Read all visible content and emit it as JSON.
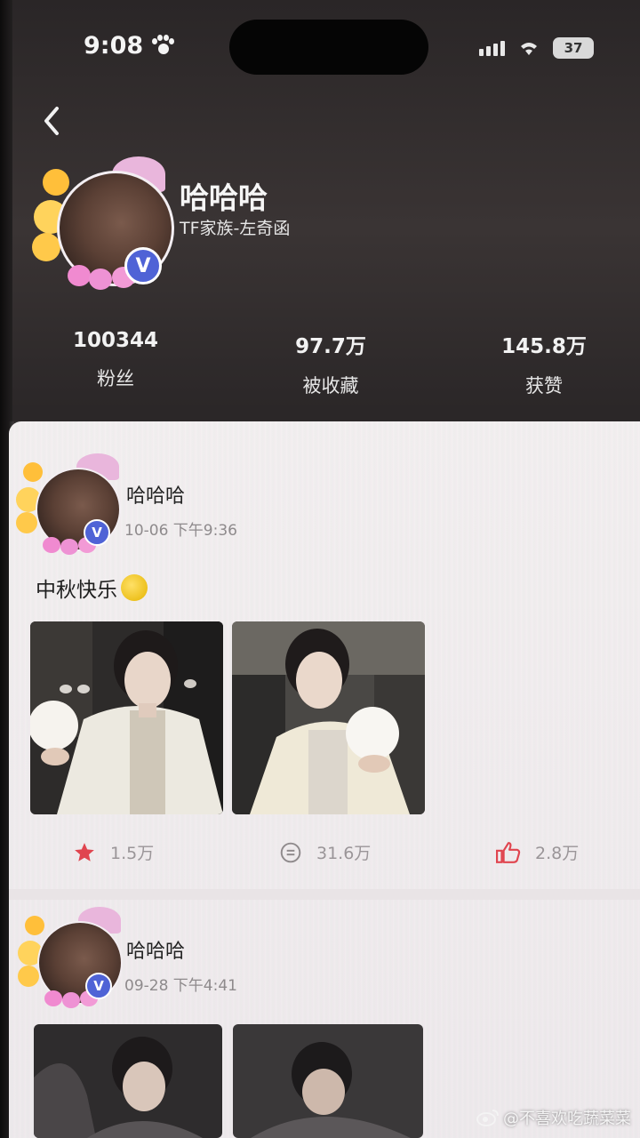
{
  "status_bar": {
    "time": "9:08",
    "battery": "37"
  },
  "profile": {
    "name": "哈哈哈",
    "subtitle": "TF家族-左奇函",
    "badge": "V",
    "stats": [
      {
        "value": "100344",
        "label": "粉丝"
      },
      {
        "value": "97.7万",
        "label": "被收藏"
      },
      {
        "value": "145.8万",
        "label": "获赞"
      }
    ]
  },
  "posts": [
    {
      "author": "哈哈哈",
      "time": "10-06 下午9:36",
      "text": "中秋快乐",
      "emoji": "moon-icon",
      "collect_count": "1.5万",
      "comment_count": "31.6万",
      "like_count": "2.8万"
    },
    {
      "author": "哈哈哈",
      "time": "09-28 下午4:41"
    }
  ],
  "watermark": "@不喜欢吃蔬菜菜",
  "colors": {
    "accent_red": "#e0454f",
    "verified_blue": "#4f63d6"
  }
}
